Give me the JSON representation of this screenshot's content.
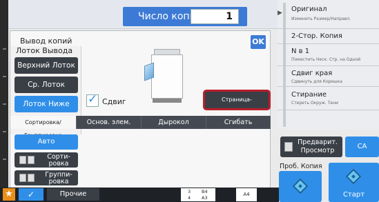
{
  "header": {
    "copies_label": "Число копий",
    "copies_value": "1"
  },
  "dialog": {
    "title": "Вывод копий",
    "ok_label": "OK",
    "output_tray": {
      "title": "Лоток Вывода",
      "options": [
        "Верхний Лоток",
        "Ср. Лоток",
        "Лоток Ниже"
      ],
      "selected": "Лоток Ниже"
    },
    "shift": {
      "label": "Сдвиг",
      "checked": true
    },
    "separator_button": "Страница-разделитель",
    "tabs": [
      "Сортировка/Группировка",
      "Основ. элем.",
      "Дырокол",
      "Сгибать"
    ],
    "selected_tab": "Сортировка/Группировка",
    "sort_options": {
      "auto": "Авто",
      "sort": "Сорти-\nровка",
      "group": "Группи-\nровка"
    }
  },
  "right_panel": {
    "items": [
      {
        "main": "Оригинал",
        "sub": "Изменить Размер/Направл."
      },
      {
        "main": "2-Стор. Копия",
        "sub": ""
      },
      {
        "main": "N в 1",
        "sub": "Поместить Неск. Стр. на Одной"
      },
      {
        "main": "Сдвиг края",
        "sub": "Сдвинуть для Корешка"
      },
      {
        "main": "Стирание",
        "sub": "Стереть Окруж. Тени"
      }
    ]
  },
  "actions": {
    "preview": "Предварит. Просмотр",
    "ca": "CA",
    "probe_copy": "Проб. Копия",
    "start": "Старт"
  },
  "bottom": {
    "other": "Прочие",
    "tray_rows": [
      [
        "3",
        "B4"
      ],
      [
        "4",
        "A3"
      ]
    ],
    "paper_size": "A4"
  },
  "colors": {
    "accent_blue": "#2f8fe8",
    "highlight_red": "#b81f2a",
    "star_orange": "#e98e1a"
  }
}
